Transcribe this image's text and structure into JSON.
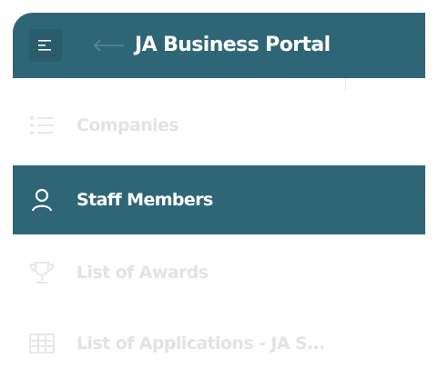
{
  "header": {
    "title": "JA Business Portal",
    "menu_icon": "menu-lines-icon",
    "back_icon": "arrow-left-icon"
  },
  "nav": {
    "items": [
      {
        "label": "Companies",
        "icon": "list-icon",
        "active": false
      },
      {
        "label": "Staff Members",
        "icon": "user-icon",
        "active": true
      },
      {
        "label": "List of Awards",
        "icon": "trophy-icon",
        "active": false
      },
      {
        "label": "List of Applications - JA S...",
        "icon": "table-icon",
        "active": false
      }
    ]
  },
  "colors": {
    "header_bg": "#2e6677",
    "active_bg": "#2e6677",
    "inactive_text": "#e3e3e3",
    "active_text": "#ffffff"
  }
}
